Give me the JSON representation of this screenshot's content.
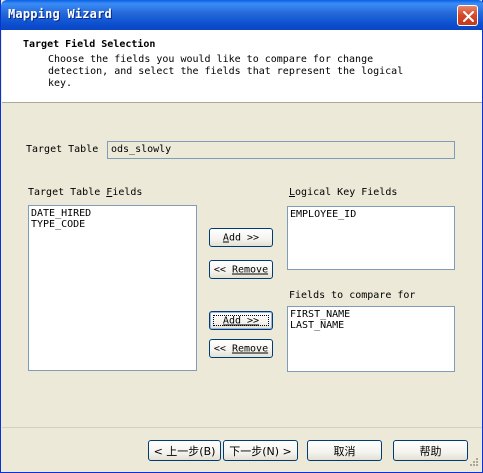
{
  "window": {
    "title": "Mapping Wizard"
  },
  "header": {
    "title": "Target Field Selection",
    "description_lines": [
      "Choose the fields you would like to compare for change",
      "detection, and select the fields that represent the logical",
      "key."
    ]
  },
  "target_table": {
    "label": "Target Table",
    "value": "ods_slowly"
  },
  "target_fields": {
    "label_prefix": "Target Table ",
    "label_hotkey": "F",
    "label_suffix": "ields",
    "items": [
      "DATE_HIRED",
      "TYPE_CODE"
    ]
  },
  "logical_key": {
    "label_hotkey": "L",
    "label_suffix": "ogical Key Fields",
    "items": [
      "EMPLOYEE_ID"
    ]
  },
  "compare_fields": {
    "label": "Fields to compare for",
    "items": [
      "FIRST_NAME",
      "LAST_NAME"
    ]
  },
  "buttons": {
    "add_key": {
      "hotkey": "A",
      "rest": "dd >>"
    },
    "remove_key": {
      "prefix": "<< ",
      "hotkey": "R",
      "rest": "emove"
    },
    "add_compare": {
      "hotkey": "A",
      "rest": "dd >>"
    },
    "remove_compare": {
      "prefix": "<< ",
      "hotkey": "R",
      "rest": "emove"
    },
    "back": "< 上一步(B)",
    "next": "下一步(N) >",
    "cancel": "取消",
    "help": "帮助"
  },
  "colors": {
    "title_bar": "#0c4fd0",
    "dialog_bg": "#ece9d8",
    "list_border": "#7f9db9",
    "button_border": "#003c74"
  }
}
